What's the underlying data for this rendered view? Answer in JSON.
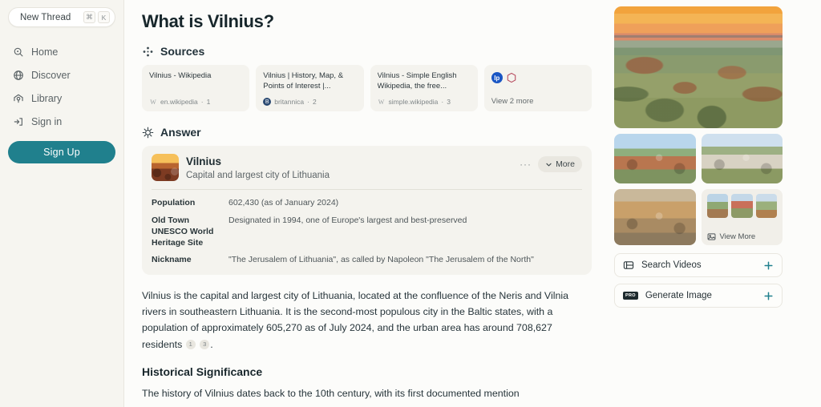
{
  "sidebar": {
    "new_thread": {
      "label": "New Thread",
      "kbd": [
        "⌘",
        "K"
      ]
    },
    "items": [
      {
        "label": "Home",
        "icon": "home-search-icon"
      },
      {
        "label": "Discover",
        "icon": "globe-icon"
      },
      {
        "label": "Library",
        "icon": "library-icon"
      },
      {
        "label": "Sign in",
        "icon": "sign-in-icon"
      }
    ],
    "signup_label": "Sign Up"
  },
  "main": {
    "title": "What is Vilnius?",
    "sources": {
      "heading": "Sources",
      "cards": [
        {
          "title": "Vilnius - Wikipedia",
          "domain": "en.wikipedia",
          "index": "1",
          "favicon": "wikipedia-favicon"
        },
        {
          "title": "Vilnius | History, Map, & Points of Interest |...",
          "domain": "britannica",
          "index": "2",
          "favicon": "britannica-favicon"
        },
        {
          "title": "Vilnius - Simple English Wikipedia, the free...",
          "domain": "simple.wikipedia",
          "index": "3",
          "favicon": "wikipedia-favicon"
        }
      ],
      "view_more": {
        "label": "View 2 more",
        "badge": "lp"
      }
    },
    "answer": {
      "heading": "Answer",
      "entity": {
        "name": "Vilnius",
        "subtitle": "Capital and largest city of Lithuania",
        "more_label": "More",
        "dots_label": "···"
      },
      "facts": [
        {
          "key": "Population",
          "value": "602,430 (as of January 2024)"
        },
        {
          "key": "Old Town UNESCO World Heritage Site",
          "value": "Designated in 1994, one of Europe's largest and best-preserved"
        },
        {
          "key": "Nickname",
          "value": "\"The Jerusalem of Lithuania\", as called by Napoleon \"The Jerusalem of the North\""
        }
      ],
      "paragraph": "Vilnius is the capital and largest city of Lithuania, located at the confluence of the Neris and Vilnia rivers in southeastern Lithuania. It is the second-most populous city in the Baltic states, with a population of approximately 605,270 as of July 2024, and the urban area has around 708,627 residents",
      "citations": [
        "1",
        "3"
      ],
      "section_heading": "Historical Significance",
      "section_paragraph": "The history of Vilnius dates back to the 10th century, with its first documented mention"
    }
  },
  "rail": {
    "hero_alt": "vilnius-sunset-aerial-panorama",
    "tiles": [
      "vilnius-old-town-rooftops",
      "vilnius-cathedral-square-autumn",
      "vilnius-old-town-street-cafes"
    ],
    "view_more_label": "View More",
    "actions": [
      {
        "label": "Search Videos",
        "icon": "video-icon",
        "pro": false,
        "plus": "+"
      },
      {
        "label": "Generate Image",
        "icon": "pro-badge",
        "pro": true,
        "pro_text": "PRO",
        "plus": "+"
      }
    ]
  },
  "colors": {
    "accent": "#20808d",
    "page_bg": "#fcfcfa",
    "sidebar_bg": "#f6f5f0",
    "card_bg": "#f4f3ee"
  }
}
